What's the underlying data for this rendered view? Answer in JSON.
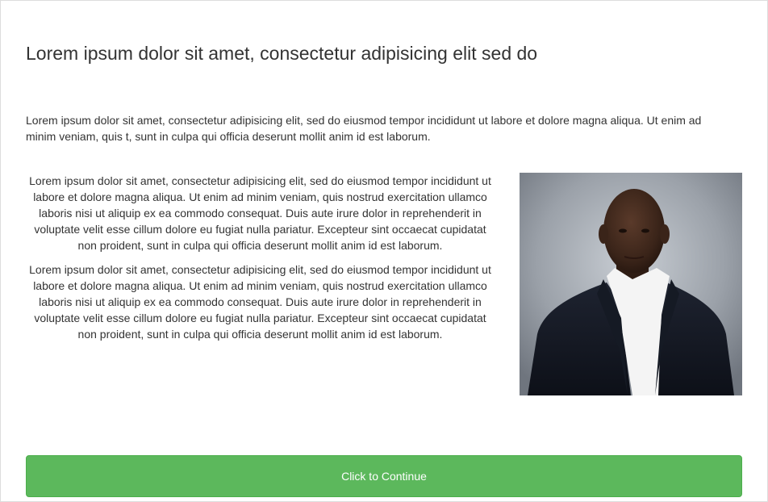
{
  "page": {
    "title": "Lorem ipsum dolor sit amet, consectetur adipisicing elit sed do",
    "intro": "Lorem ipsum dolor sit amet, consectetur adipisicing elit, sed do eiusmod tempor incididunt ut labore et dolore magna aliqua. Ut enim ad minim veniam, quis t, sunt in culpa qui officia deserunt mollit anim id est laborum.",
    "paragraphs": [
      "Lorem ipsum dolor sit amet, consectetur adipisicing elit, sed do eiusmod tempor incididunt ut labore et dolore magna aliqua. Ut enim ad minim veniam, quis nostrud exercitation ullamco laboris nisi ut aliquip ex ea commodo consequat. Duis aute irure dolor in reprehenderit in voluptate velit esse cillum dolore eu fugiat nulla pariatur. Excepteur sint occaecat cupidatat non proident, sunt in culpa qui officia deserunt mollit anim id est laborum.",
      "Lorem ipsum dolor sit amet, consectetur adipisicing elit, sed do eiusmod tempor incididunt ut labore et dolore magna aliqua. Ut enim ad minim veniam, quis nostrud exercitation ullamco laboris nisi ut aliquip ex ea commodo consequat. Duis aute irure dolor in reprehenderit in voluptate velit esse cillum dolore eu fugiat nulla pariatur. Excepteur sint occaecat cupidatat non proident, sunt in culpa qui officia deserunt mollit anim id est laborum."
    ],
    "continue_label": "Click to Continue"
  },
  "colors": {
    "button_green": "#5cb85c",
    "text": "#333333"
  }
}
